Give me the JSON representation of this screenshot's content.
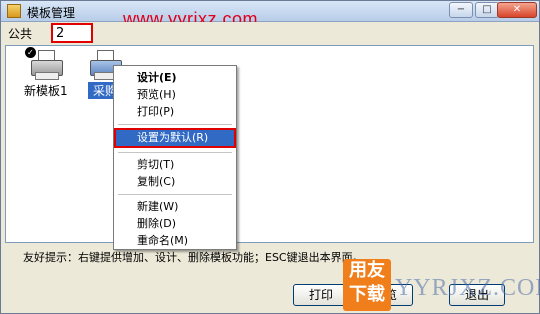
{
  "window": {
    "title": "模板管理",
    "minimize": "−",
    "restore": "□",
    "close": "✕"
  },
  "watermark": {
    "url": "www.yyrjxz.com",
    "logo_top": "用友",
    "logo_bottom": "下载",
    "brand": "YYRJXZ.COM"
  },
  "filter": {
    "label": "公共",
    "value": "2"
  },
  "templates": [
    {
      "label": "新模板1",
      "default": true,
      "selected": false
    },
    {
      "label": "采购",
      "default": false,
      "selected": true
    }
  ],
  "context_menu": {
    "items": [
      {
        "label": "设计(E)",
        "bold": true
      },
      {
        "label": "预览(H)"
      },
      {
        "label": "打印(P)"
      },
      {
        "label": "设置为默认(R)",
        "highlighted": true
      },
      {
        "label": "剪切(T)"
      },
      {
        "label": "复制(C)"
      },
      {
        "label": "新建(W)"
      },
      {
        "label": "删除(D)"
      },
      {
        "label": "重命名(M)"
      }
    ]
  },
  "hint": "友好提示：右键提供增加、设计、删除模板功能；ESC键退出本界面。",
  "footer": {
    "print_label": "打印",
    "preview_label": "预览",
    "exit_label": "退出"
  },
  "colors": {
    "selection": "#316ac5",
    "annotation_red": "#e00000",
    "logo_orange": "#f07e1a"
  }
}
